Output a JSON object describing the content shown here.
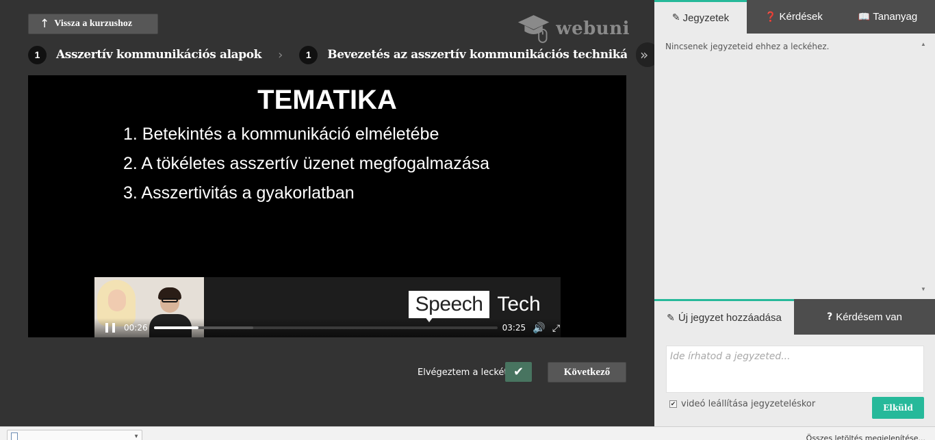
{
  "header": {
    "back_label": "Vissza a kurzushoz",
    "logo_text": "webuni"
  },
  "breadcrumb": {
    "items": [
      {
        "number": "1",
        "label": "Asszertív kommunikációs alapok"
      },
      {
        "number": "1",
        "label": "Bevezetés az asszertív kommunikációs technikába"
      }
    ],
    "separator": "›",
    "next_icon": "double-chevron-right"
  },
  "video": {
    "slide_title": "TEMATIKA",
    "slide_items": [
      "1. Betekintés a kommunikáció elméletébe",
      "2. A tökéletes asszertív üzenet megfogalmazása",
      "3. Asszertivitás a gyakorlatban"
    ],
    "brand_left": "Speech",
    "brand_right": "Tech",
    "current_time": "00:26",
    "duration": "03:25",
    "played_fraction": 0.13,
    "buffered_fraction": 0.29
  },
  "lesson": {
    "complete_label": "Elvégeztem a leckét",
    "next_label": "Következő"
  },
  "panel": {
    "tabs": [
      {
        "label": "Jegyzetek",
        "icon": "pencil-icon",
        "active": true
      },
      {
        "label": "Kérdések",
        "icon": "question-circle-icon",
        "active": false
      },
      {
        "label": "Tananyag",
        "icon": "book-icon",
        "active": false
      }
    ],
    "empty_message": "Nincsenek jegyzeteid ehhez a leckéhez.",
    "bottom_tabs": [
      {
        "label": "Új jegyzet hozzáadása",
        "icon": "pencil-icon",
        "active": true
      },
      {
        "label": "Kérdésem van",
        "icon": "question-icon",
        "active": false
      }
    ],
    "note_placeholder": "Ide írhatod a jegyzeted...",
    "pause_on_note_label": "videó leállítása jegyzeteléskor",
    "pause_on_note_checked": true,
    "send_label": "Elküld"
  },
  "colors": {
    "accent": "#26b99a",
    "dark_bg": "#333333",
    "panel_bg": "#ebebeb",
    "check_green": "#487460"
  },
  "downloadbar": {
    "item_name": "",
    "right_text": "Összes letöltés megjelenítése..."
  }
}
